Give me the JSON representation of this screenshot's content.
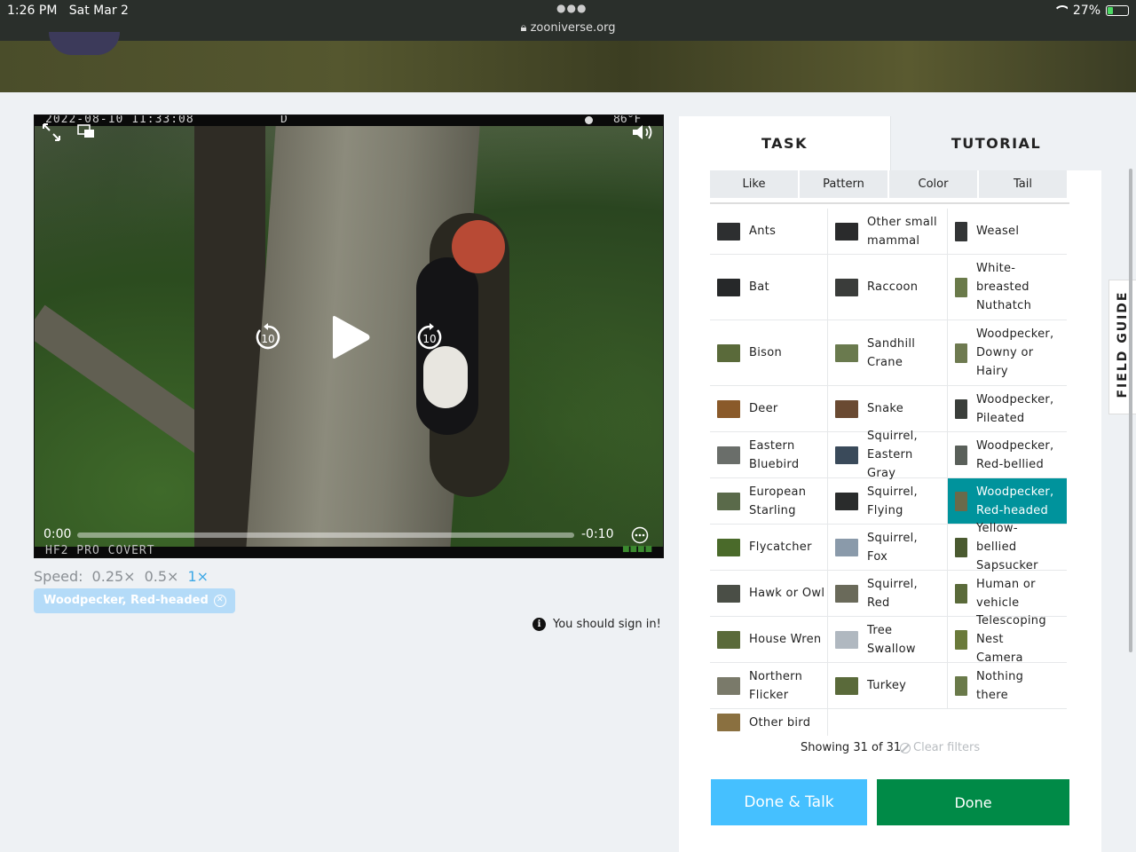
{
  "status": {
    "time": "1:26 PM",
    "date": "Sat Mar 2",
    "url": "zooniverse.org",
    "battery": "27%",
    "battery_level": 0.27
  },
  "player": {
    "timestamp": "2022-08-10 11:33:08",
    "flag": "D",
    "temperature": "86°F",
    "camera_model": "HF2 PRO COVERT",
    "current_time": "0:00",
    "remaining_time": "-0:10",
    "replay_seconds": "10",
    "forward_seconds": "10"
  },
  "speed": {
    "label": "Speed:",
    "options": [
      "0.25×",
      "0.5×",
      "1×"
    ],
    "selected": "1×"
  },
  "selected_chip": "Woodpecker, Red-headed",
  "sign_in_notice": "You should sign in!",
  "tabs": {
    "task": "TASK",
    "tutorial": "TUTORIAL"
  },
  "filters": [
    "Like",
    "Pattern",
    "Color",
    "Tail"
  ],
  "choices": [
    [
      "Ants",
      "Other small mammal",
      "Weasel"
    ],
    [
      "Bat",
      "Raccoon",
      "White-breasted Nuthatch"
    ],
    [
      "Bison",
      "Sandhill Crane",
      "Woodpecker, Downy or Hairy"
    ],
    [
      "Deer",
      "Snake",
      "Woodpecker, Pileated"
    ],
    [
      "Eastern Bluebird",
      "Squirrel, Eastern Gray",
      "Woodpecker, Red-bellied"
    ],
    [
      "European Starling",
      "Squirrel, Flying",
      "Woodpecker, Red-headed"
    ],
    [
      "Flycatcher",
      "Squirrel, Fox",
      "Yellow-bellied Sapsucker"
    ],
    [
      "Hawk or Owl",
      "Squirrel, Red",
      "Human or vehicle"
    ],
    [
      "House Wren",
      "Tree Swallow",
      "Telescoping Nest Camera"
    ],
    [
      "Northern Flicker",
      "Turkey",
      "Nothing there"
    ],
    [
      "Other bird"
    ]
  ],
  "selected_choice": "Woodpecker, Red-headed",
  "showing": "Showing 31 of 31",
  "clear_filters": "Clear filters",
  "buttons": {
    "done_talk": "Done & Talk",
    "done": "Done"
  },
  "field_guide": "FIELD GUIDE",
  "colors": {
    "accent_blue": "#45c0ff",
    "done_green": "#008a47",
    "selected_teal": "#00939c",
    "chip_blue": "#b4dbf8"
  }
}
